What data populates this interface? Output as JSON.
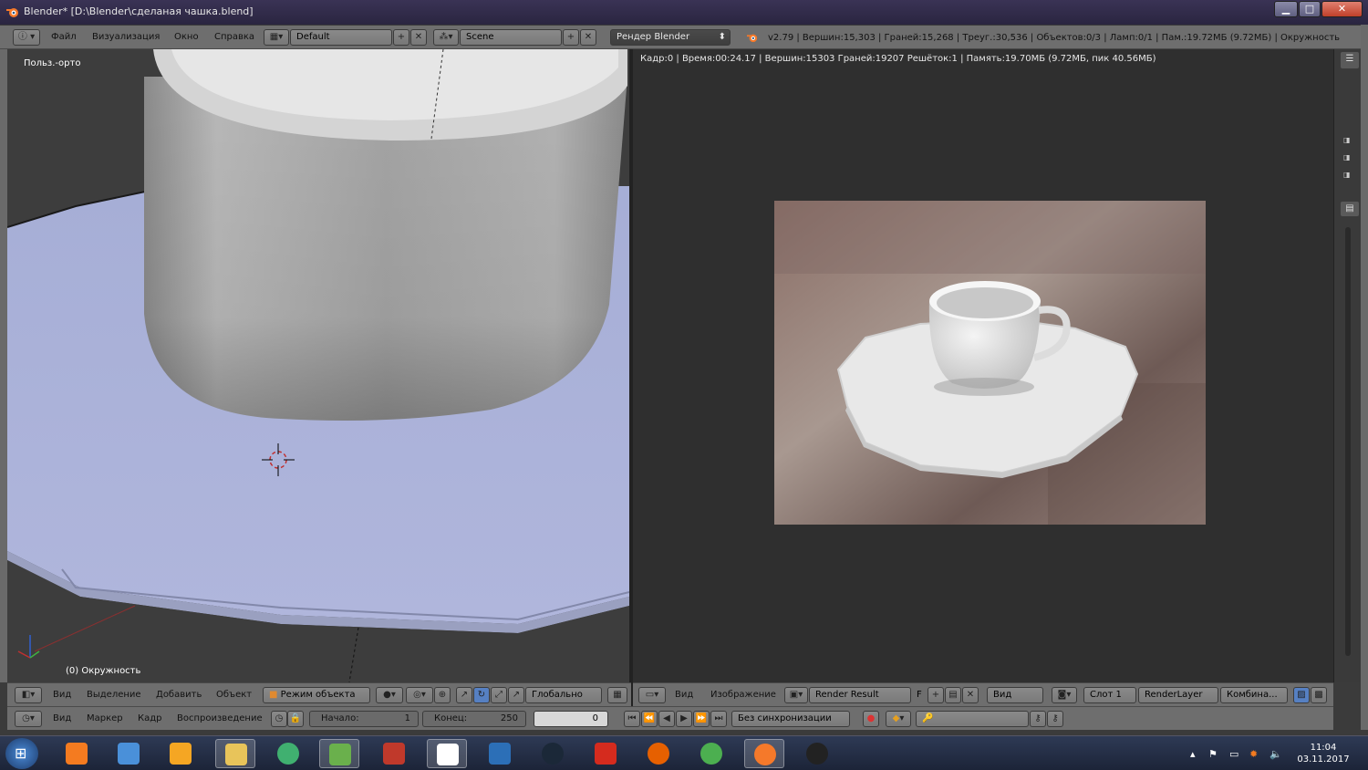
{
  "window": {
    "title": "Blender* [D:\\Blender\\сделаная чашка.blend]",
    "controls": {
      "minimize": "▁",
      "maximize": "□",
      "close": "✕"
    }
  },
  "info_header": {
    "menu": [
      "Файл",
      "Визуализация",
      "Окно",
      "Справка"
    ],
    "layout": "Default",
    "scene": "Scene",
    "engine": "Рендер Blender",
    "stats": "v2.79 | Вершин:15,303 | Граней:15,268 | Треуг.:30,536 | Объектов:0/3 | Ламп:0/1 | Пам.:19.72МБ (9.72МБ) | Окружность"
  },
  "viewport": {
    "view_label": "Польз.-орто",
    "object_label": "(0) Окружность"
  },
  "image_editor": {
    "render_info": "Кадр:0 | Время:00:24.17 | Вершин:15303 Граней:19207 Решёток:1 | Память:19.70МБ (9.72МБ, пик 40.56МБ)"
  },
  "viewport_header": {
    "menu": [
      "Вид",
      "Выделение",
      "Добавить",
      "Объект"
    ],
    "mode": "Режим объекта",
    "orientation": "Глобально"
  },
  "image_header": {
    "menu": [
      "Вид",
      "Изображение"
    ],
    "image_name": "Render Result",
    "fake_user": "F",
    "view": "Вид",
    "slot": "Слот 1",
    "layer": "RenderLayer",
    "pass": "Комбина..."
  },
  "timeline": {
    "menu": [
      "Вид",
      "Маркер",
      "Кадр",
      "Воспроизведение"
    ],
    "start_label": "Начало:",
    "start_value": "1",
    "end_label": "Конец:",
    "end_value": "250",
    "current_frame": "0",
    "sync": "Без синхронизации"
  },
  "taskbar": {
    "time": "11:04",
    "date": "03.11.2017",
    "apps": [
      "start",
      "avast",
      "control-panel",
      "media-player",
      "explorer",
      "atom",
      "utorrent",
      "app-red",
      "app-square",
      "battlenet",
      "steam",
      "canada-flag",
      "firefox",
      "chrome",
      "blender",
      "obs"
    ],
    "colors": {
      "avast": "#f47b20",
      "control-panel": "#4a90d9",
      "media-player": "#f5a623",
      "explorer": "#e8c45a",
      "atom": "#40b070",
      "utorrent": "#6ab04c",
      "app-red": "#c0392b",
      "app-square": "#ffffff",
      "battlenet": "#2c6fb7",
      "steam": "#1b2838",
      "canada-flag": "#d52b1e",
      "firefox": "#e66000",
      "chrome": "#4caf50",
      "blender": "#f5792a",
      "obs": "#222222"
    }
  }
}
